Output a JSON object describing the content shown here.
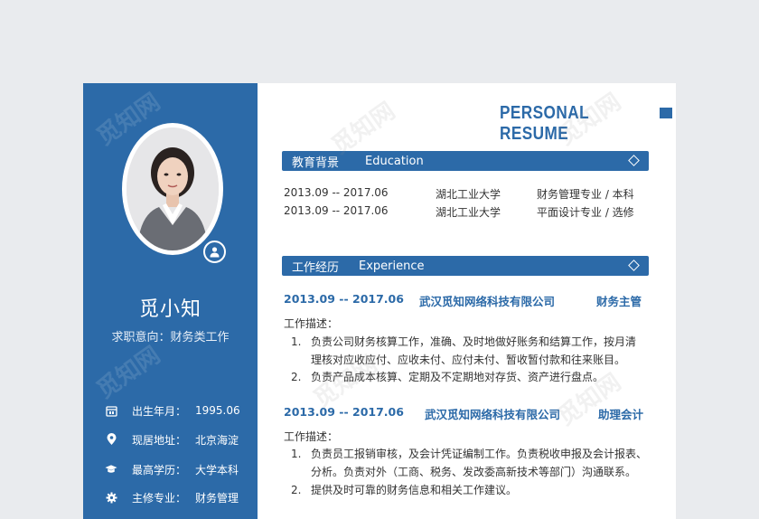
{
  "header": {
    "title": "PERSONAL RESUME"
  },
  "profile": {
    "name": "觅小知",
    "objective": "求职意向：财务类工作",
    "info": [
      {
        "icon": "calendar-icon",
        "label": "出生年月：",
        "value": "1995.06"
      },
      {
        "icon": "location-pin-icon",
        "label": "现居地址：",
        "value": "北京海淀"
      },
      {
        "icon": "graduation-cap-icon",
        "label": "最高学历：",
        "value": "大学本科"
      },
      {
        "icon": "gear-icon",
        "label": "主修专业：",
        "value": "财务管理"
      }
    ]
  },
  "education": {
    "title_cn": "教育背景",
    "title_en": "Education",
    "rows": [
      {
        "dates": "2013.09 -- 2017.06",
        "school": "湖北工业大学",
        "major": "财务管理专业  /  本科"
      },
      {
        "dates": "2013.09 -- 2017.06",
        "school": "湖北工业大学",
        "major": "平面设计专业  /  选修"
      }
    ]
  },
  "experience": {
    "title_cn": "工作经历",
    "title_en": "Experience",
    "jobs": [
      {
        "dates": "2013.09 -- 2017.06",
        "company": "武汉觅知网络科技有限公司",
        "role": "财务主管",
        "desc_label": "工作描述：",
        "items": [
          {
            "num": "1.",
            "lines": [
              "负责公司财务核算工作，准确、及时地做好账务和结算工作，按月清",
              "理核对应收应付、应收未付、应付未付、暂收暂付款和往来账目。"
            ]
          },
          {
            "num": "2.",
            "lines": [
              "负责产品成本核算、定期及不定期地对存货、资产进行盘点。"
            ]
          }
        ]
      },
      {
        "dates": "2013.09 -- 2017.06",
        "company": "武汉觅知网络科技有限公司",
        "role": "助理会计",
        "desc_label": "工作描述：",
        "items": [
          {
            "num": "1.",
            "lines": [
              "负责员工报销审核，及会计凭证编制工作。负责税收申报及会计报表、",
              "分析。负责对外（工商、税务、发改委高新技术等部门）沟通联系。"
            ]
          },
          {
            "num": "2.",
            "lines": [
              "提供及时可靠的财务信息和相关工作建议。"
            ]
          }
        ]
      }
    ]
  },
  "watermark": "觅知网",
  "colors": {
    "primary": "#2c6aa8",
    "page_bg": "#e9ebee"
  }
}
